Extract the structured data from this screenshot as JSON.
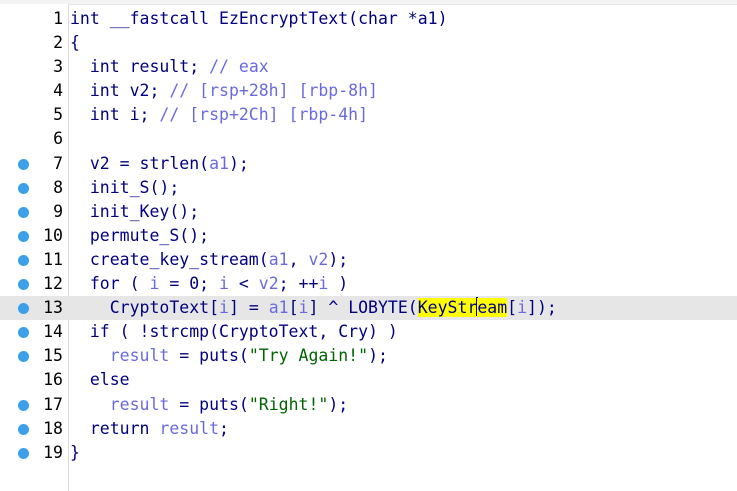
{
  "lines": [
    {
      "num": "1",
      "bp": false,
      "parts": [
        {
          "t": "int __fastcall EzEncryptText(char *",
          "c": ""
        },
        {
          "t": "a1",
          "c": ""
        },
        {
          "t": ")",
          "c": ""
        }
      ]
    },
    {
      "num": "2",
      "bp": false,
      "parts": [
        {
          "t": "{",
          "c": ""
        }
      ]
    },
    {
      "num": "3",
      "bp": false,
      "parts": [
        {
          "t": "  int result; ",
          "c": ""
        },
        {
          "t": "// eax",
          "c": "gray"
        }
      ]
    },
    {
      "num": "4",
      "bp": false,
      "parts": [
        {
          "t": "  int v2; ",
          "c": ""
        },
        {
          "t": "// [rsp+28h] [rbp-8h]",
          "c": "gray"
        }
      ]
    },
    {
      "num": "5",
      "bp": false,
      "parts": [
        {
          "t": "  int i; ",
          "c": ""
        },
        {
          "t": "// [rsp+2Ch] [rbp-4h]",
          "c": "gray"
        }
      ]
    },
    {
      "num": "6",
      "bp": false,
      "parts": [
        {
          "t": "",
          "c": ""
        }
      ]
    },
    {
      "num": "7",
      "bp": true,
      "parts": [
        {
          "t": "  v2 = strlen(",
          "c": ""
        },
        {
          "t": "a1",
          "c": "gray"
        },
        {
          "t": ");",
          "c": ""
        }
      ]
    },
    {
      "num": "8",
      "bp": true,
      "parts": [
        {
          "t": "  init_S();",
          "c": ""
        }
      ]
    },
    {
      "num": "9",
      "bp": true,
      "parts": [
        {
          "t": "  init_Key();",
          "c": ""
        }
      ]
    },
    {
      "num": "10",
      "bp": true,
      "parts": [
        {
          "t": "  permute_S();",
          "c": ""
        }
      ]
    },
    {
      "num": "11",
      "bp": true,
      "parts": [
        {
          "t": "  create_key_stream(",
          "c": ""
        },
        {
          "t": "a1",
          "c": "gray"
        },
        {
          "t": ", ",
          "c": ""
        },
        {
          "t": "v2",
          "c": "gray"
        },
        {
          "t": ");",
          "c": ""
        }
      ]
    },
    {
      "num": "12",
      "bp": true,
      "parts": [
        {
          "t": "  for ( ",
          "c": ""
        },
        {
          "t": "i",
          "c": "gray"
        },
        {
          "t": " = 0; ",
          "c": ""
        },
        {
          "t": "i",
          "c": "gray"
        },
        {
          "t": " < ",
          "c": ""
        },
        {
          "t": "v2",
          "c": "gray"
        },
        {
          "t": "; ++",
          "c": ""
        },
        {
          "t": "i",
          "c": "gray"
        },
        {
          "t": " )",
          "c": ""
        }
      ]
    },
    {
      "num": "13",
      "bp": true,
      "current": true,
      "parts": [
        {
          "t": "    CryptoText[",
          "c": ""
        },
        {
          "t": "i",
          "c": "gray"
        },
        {
          "t": "] = ",
          "c": ""
        },
        {
          "t": "a1",
          "c": "gray"
        },
        {
          "t": "[",
          "c": ""
        },
        {
          "t": "i",
          "c": "gray"
        },
        {
          "t": "] ^ LOBYTE(",
          "c": ""
        },
        {
          "t": "KeyStr",
          "c": "hl"
        },
        {
          "t": "|caret|",
          "c": "caret"
        },
        {
          "t": "eam",
          "c": "hl"
        },
        {
          "t": "[",
          "c": ""
        },
        {
          "t": "i",
          "c": "gray"
        },
        {
          "t": "]);",
          "c": ""
        }
      ]
    },
    {
      "num": "14",
      "bp": true,
      "parts": [
        {
          "t": "  if ( !strcmp(CryptoText, Cry) )",
          "c": ""
        }
      ]
    },
    {
      "num": "15",
      "bp": true,
      "parts": [
        {
          "t": "    ",
          "c": ""
        },
        {
          "t": "result",
          "c": "gray"
        },
        {
          "t": " = puts(",
          "c": ""
        },
        {
          "t": "\"Try Again!\"",
          "c": "str"
        },
        {
          "t": ");",
          "c": ""
        }
      ]
    },
    {
      "num": "16",
      "bp": false,
      "parts": [
        {
          "t": "  else",
          "c": ""
        }
      ]
    },
    {
      "num": "17",
      "bp": true,
      "parts": [
        {
          "t": "    ",
          "c": ""
        },
        {
          "t": "result",
          "c": "gray"
        },
        {
          "t": " = puts(",
          "c": ""
        },
        {
          "t": "\"Right!\"",
          "c": "str"
        },
        {
          "t": ");",
          "c": ""
        }
      ]
    },
    {
      "num": "18",
      "bp": true,
      "parts": [
        {
          "t": "  return ",
          "c": ""
        },
        {
          "t": "result",
          "c": "gray"
        },
        {
          "t": ";",
          "c": ""
        }
      ]
    },
    {
      "num": "19",
      "bp": true,
      "parts": [
        {
          "t": "}",
          "c": ""
        }
      ]
    }
  ]
}
